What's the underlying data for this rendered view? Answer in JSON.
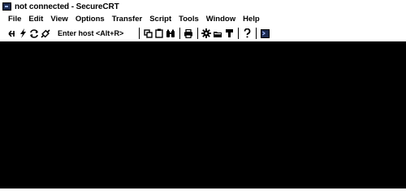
{
  "window": {
    "title": "not connected - SecureCRT"
  },
  "menu": {
    "items": [
      "File",
      "Edit",
      "View",
      "Options",
      "Transfer",
      "Script",
      "Tools",
      "Window",
      "Help"
    ]
  },
  "toolbar": {
    "host_prompt": "Enter host <Alt+R>",
    "icons": [
      "connect-icon",
      "quick-connect-icon",
      "reconnect-icon",
      "connect-in-tab-icon",
      "copy-icon",
      "paste-icon",
      "find-icon",
      "print-icon",
      "settings-icon",
      "sftp-icon",
      "keymap-icon",
      "help-icon",
      "terminal-icon"
    ]
  },
  "colors": {
    "terminal_background": "#000000",
    "chrome_background": "#ffffff"
  }
}
